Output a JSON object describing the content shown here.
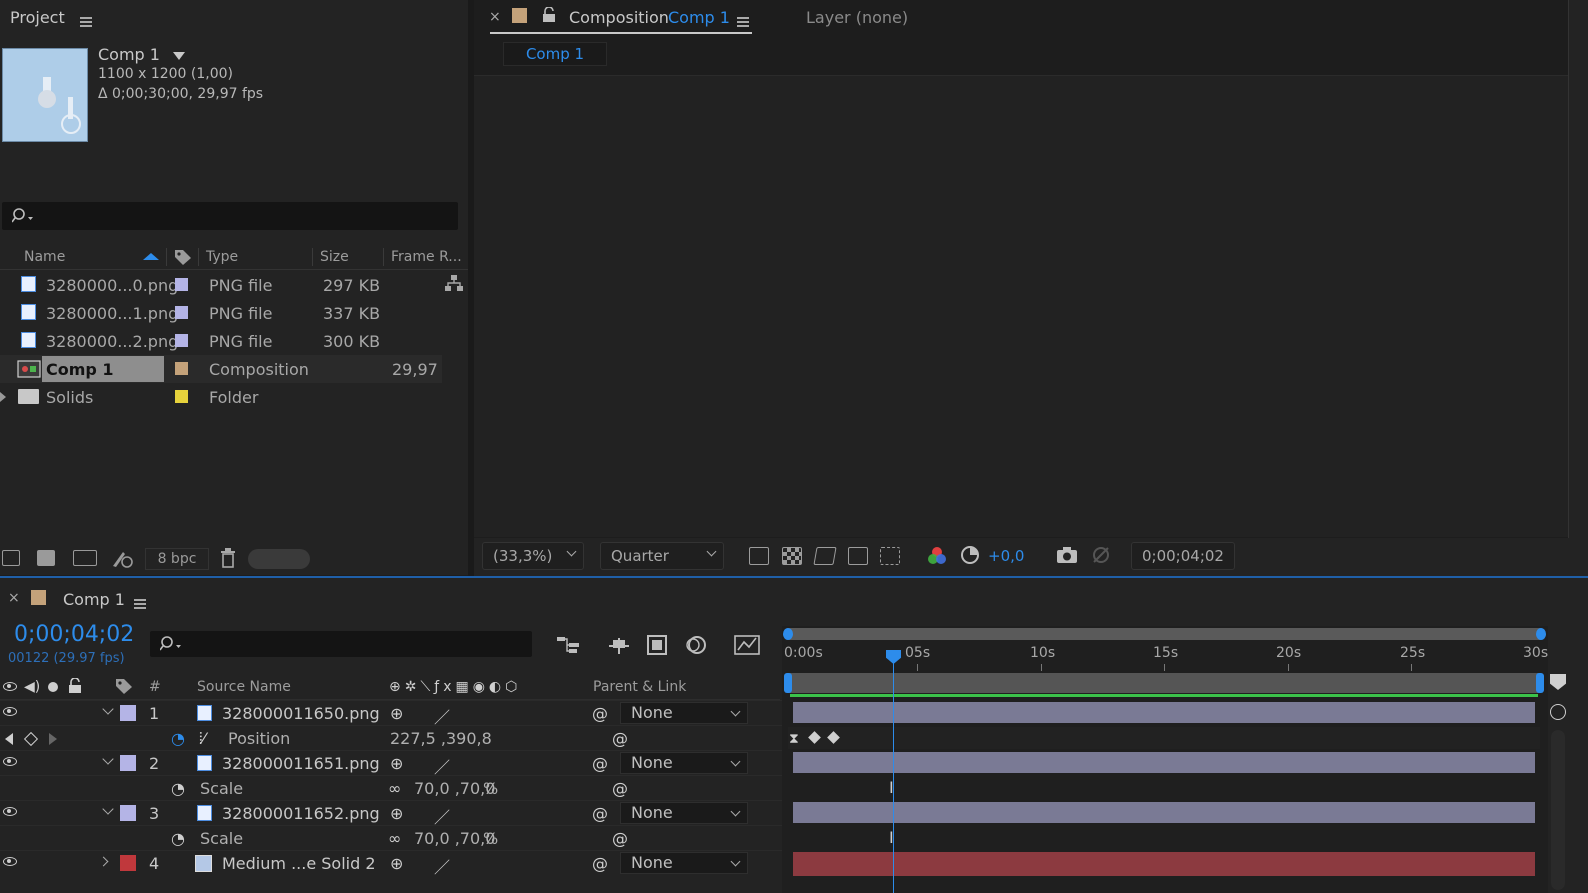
{
  "project": {
    "title": "Project",
    "comp_name": "Comp 1",
    "comp_dims": "1100 x 1200 (1,00)",
    "comp_duration": "Δ 0;00;30;00, 29,97 fps",
    "columns": {
      "name": "Name",
      "type": "Type",
      "size": "Size",
      "frame_rate": "Frame R..."
    },
    "items": [
      {
        "name": "3280000...0.png",
        "type": "PNG file",
        "size": "297 KB",
        "frame_rate": "",
        "label_color": "#b4b4e6"
      },
      {
        "name": "3280000...1.png",
        "type": "PNG file",
        "size": "337 KB",
        "frame_rate": "",
        "label_color": "#b4b4e6"
      },
      {
        "name": "3280000...2.png",
        "type": "PNG file",
        "size": "300 KB",
        "frame_rate": "",
        "label_color": "#b4b4e6"
      },
      {
        "name": "Comp 1",
        "type": "Composition",
        "size": "",
        "frame_rate": "29,97",
        "label_color": "#c4a27a"
      },
      {
        "name": "Solids",
        "type": "Folder",
        "size": "",
        "frame_rate": "",
        "label_color": "#e6d23c"
      }
    ],
    "bpc": "8 bpc"
  },
  "viewer": {
    "tab_prefix": "Composition",
    "tab_comp": "Comp 1",
    "layer_tab": "Layer (none)",
    "breadcrumb": "Comp 1",
    "zoom": "(33,3%)",
    "resolution": "Quarter",
    "exposure": "+0,0",
    "timecode": "0;00;04;02"
  },
  "timeline": {
    "tab": "Comp 1",
    "timecode": "0;00;04;02",
    "frames": "00122 (29.97 fps)",
    "columns": {
      "num": "#",
      "source": "Source Name",
      "parent": "Parent & Link"
    },
    "ruler": [
      "0:00s",
      "05s",
      "10s",
      "15s",
      "20s",
      "25s",
      "30s"
    ],
    "layers": [
      {
        "num": "1",
        "name": "328000011650.png",
        "parent": "None",
        "label_color": "#b4b4e6",
        "prop_name": "Position",
        "prop_value": "227,5 ,390,8",
        "prop_unit": ""
      },
      {
        "num": "2",
        "name": "328000011651.png",
        "parent": "None",
        "label_color": "#b4b4e6",
        "prop_name": "Scale",
        "prop_value": "70,0 ,70,0",
        "prop_unit": "%"
      },
      {
        "num": "3",
        "name": "328000011652.png",
        "parent": "None",
        "label_color": "#b4b4e6",
        "prop_name": "Scale",
        "prop_value": "70,0 ,70,0",
        "prop_unit": "%"
      },
      {
        "num": "4",
        "name": "Medium ...e Solid 2",
        "parent": "None",
        "label_color": "#c0383c"
      }
    ],
    "bar_colors": {
      "image_layer": "#7a7a95",
      "solid_layer": "#8c3a40"
    },
    "playhead_seconds": 4.07,
    "duration_seconds": 30
  }
}
